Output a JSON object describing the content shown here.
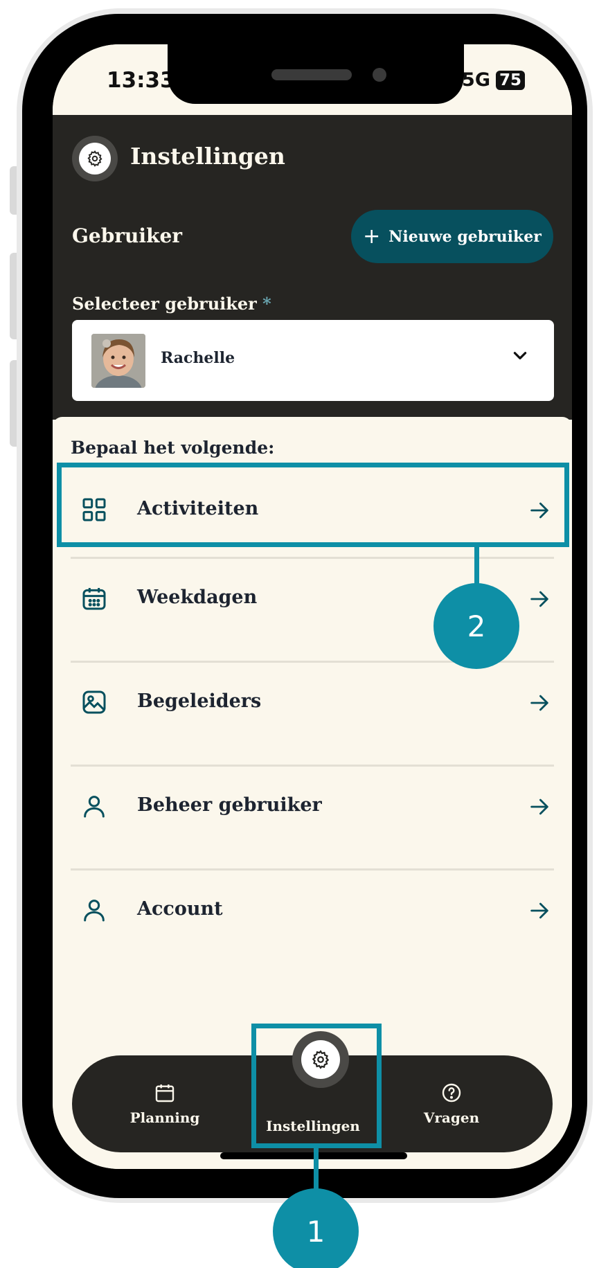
{
  "status_bar": {
    "time": "13:33",
    "network": "5G",
    "battery": "75"
  },
  "header": {
    "title": "Instellingen",
    "section_label": "Gebruiker",
    "new_user_button": "Nieuwe gebruiker",
    "select_label": "Selecteer gebruiker",
    "required_mark": "*",
    "selected_user": "Rachelle"
  },
  "panel": {
    "heading": "Bepaal het volgende:",
    "items": [
      {
        "label": "Activiteiten",
        "icon": "grid-icon"
      },
      {
        "label": "Weekdagen",
        "icon": "calendar-icon"
      },
      {
        "label": "Begeleiders",
        "icon": "image-icon"
      },
      {
        "label": "Beheer gebruiker",
        "icon": "user-icon"
      },
      {
        "label": "Account",
        "icon": "user-icon"
      }
    ]
  },
  "bottom_nav": {
    "items": [
      {
        "label": "Planning",
        "icon": "calendar-icon"
      },
      {
        "label": "Instellingen",
        "icon": "gear-icon",
        "active": true
      },
      {
        "label": "Vragen",
        "icon": "question-icon"
      }
    ]
  },
  "annotations": {
    "callout_1": "1",
    "callout_2": "2",
    "color": "#0e8fa6"
  },
  "colors": {
    "dark": "#262522",
    "cream": "#fbf7ec",
    "accent": "#07505e",
    "text": "#1d2430"
  }
}
